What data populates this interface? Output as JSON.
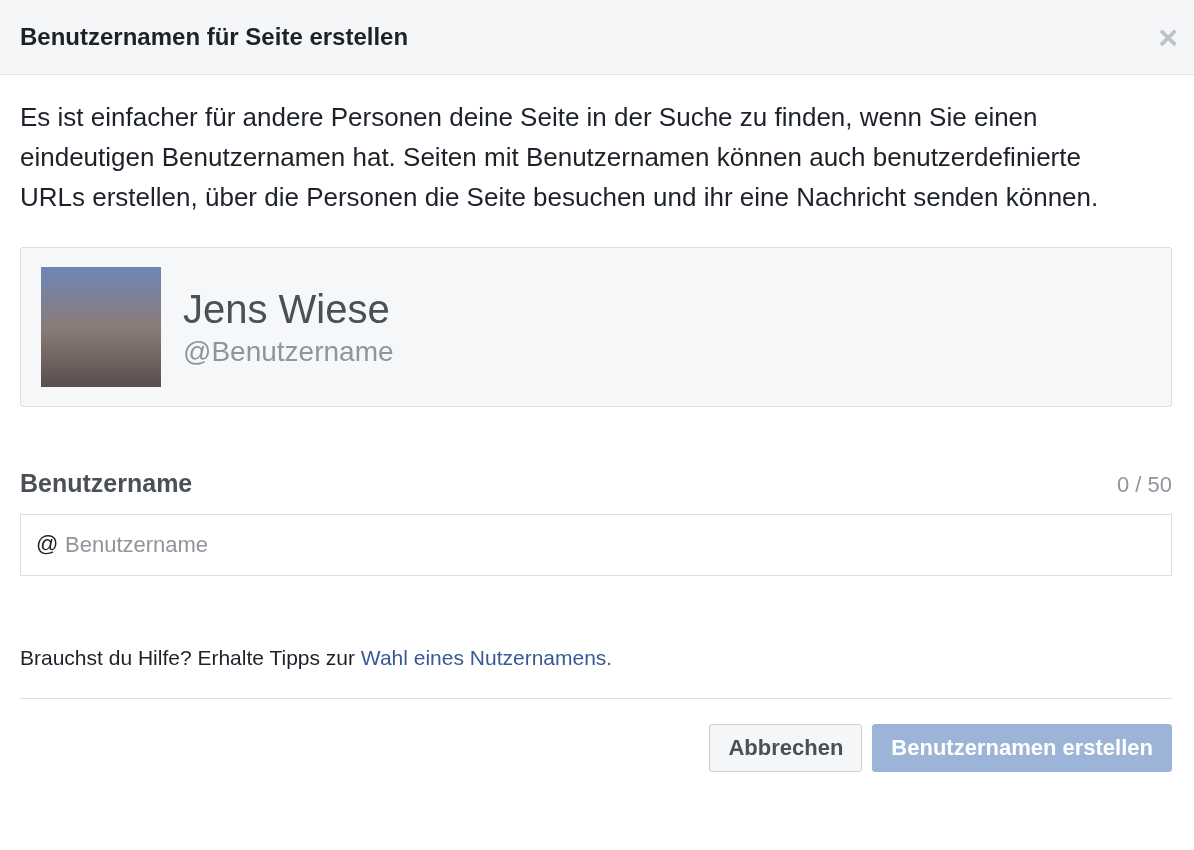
{
  "dialog": {
    "title": "Benutzernamen für Seite erstellen",
    "close": "×"
  },
  "description": "Es ist einfacher für andere Personen deine Seite in der Suche zu finden, wenn Sie einen eindeutigen Benutzernamen hat. Seiten mit Benutzernamen können auch benutzerdefinierte URLs erstellen, über die Personen die Seite besuchen und ihr eine Nachricht senden können.",
  "preview": {
    "name": "Jens Wiese",
    "handle": "@Benutzername"
  },
  "field": {
    "label": "Benutzername",
    "counter": "0 / 50",
    "prefix": "@",
    "placeholder": "Benutzername"
  },
  "help": {
    "text": "Brauchst du Hilfe? Erhalte Tipps zur",
    "link": "Wahl eines Nutzernamens."
  },
  "buttons": [
    {
      "label": "Abbrechen",
      "kind": "secondary",
      "disabled": false
    },
    {
      "label": "Benutzernamen erstellen",
      "kind": "primary",
      "disabled": true
    }
  ]
}
